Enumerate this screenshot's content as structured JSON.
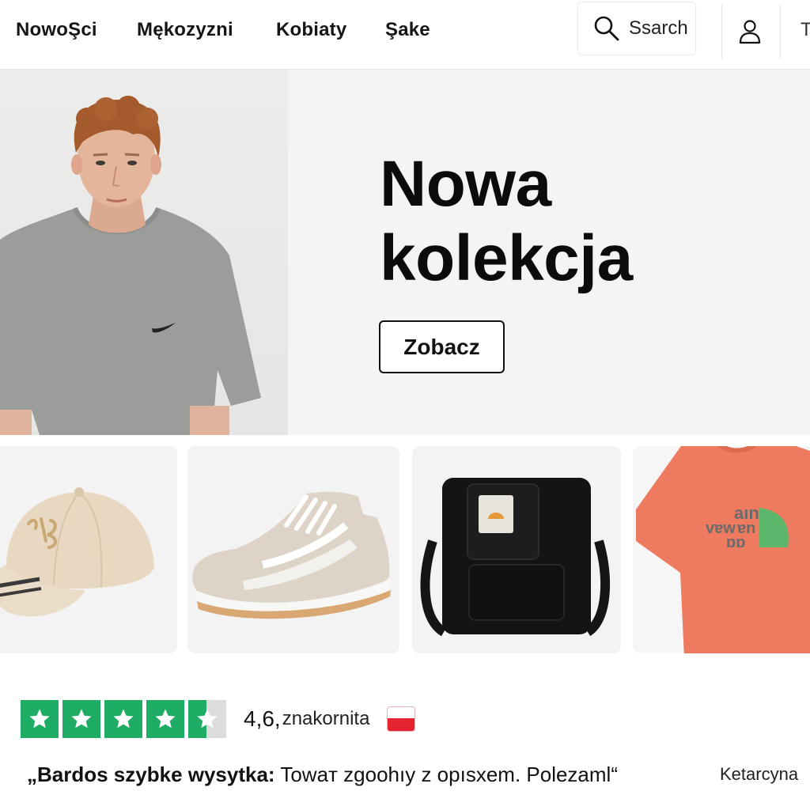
{
  "nav": {
    "items": [
      "NowoŞci",
      "Mękozyzni",
      "Kobiaty",
      "Şake"
    ],
    "search_label": "Ssarch",
    "cut_item": "T"
  },
  "hero": {
    "title_line1": "Nowa",
    "title_line2": "kolekcja",
    "cta": "Zobacz"
  },
  "products": [
    {
      "icon": "cap-icon"
    },
    {
      "icon": "sneaker-icon"
    },
    {
      "icon": "crossbody-bag-icon"
    },
    {
      "icon": "tshirt-icon"
    }
  ],
  "rating": {
    "stars": 4.5,
    "score": "4,6,",
    "label": "znakornita",
    "flag": "poland-flag-icon"
  },
  "review": {
    "bold": "„Bardos szybke wysytka:",
    "text": " Towaт zgoohıy z opısxem. Polezaml“",
    "author": "Ketarcyna"
  },
  "colors": {
    "trust_green": "#1fad66",
    "hero_bg": "#f4f4f3",
    "text": "#111111"
  }
}
